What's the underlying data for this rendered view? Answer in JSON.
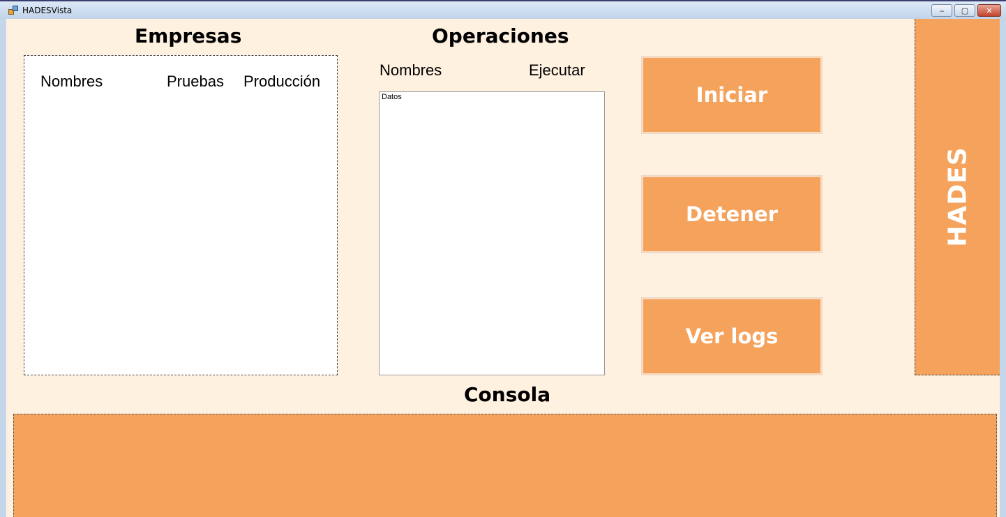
{
  "window": {
    "title": "HADESVista",
    "controls": {
      "minimize": "‒",
      "maximize": "▢",
      "close": "✕"
    }
  },
  "empresas": {
    "heading": "Empresas",
    "columns": [
      "Nombres",
      "Pruebas",
      "Producción"
    ]
  },
  "operaciones": {
    "heading": "Operaciones",
    "columns": [
      "Nombres",
      "Ejecutar"
    ],
    "list_label": "Datos"
  },
  "actions": {
    "start_label": "Iniciar",
    "stop_label": "Detener",
    "logs_label": "Ver logs"
  },
  "side_banner": {
    "label": "HADES"
  },
  "console": {
    "heading": "Consola"
  },
  "colors": {
    "accent": "#f5a25c",
    "background": "#fff1e0",
    "panel": "#ffffff"
  }
}
